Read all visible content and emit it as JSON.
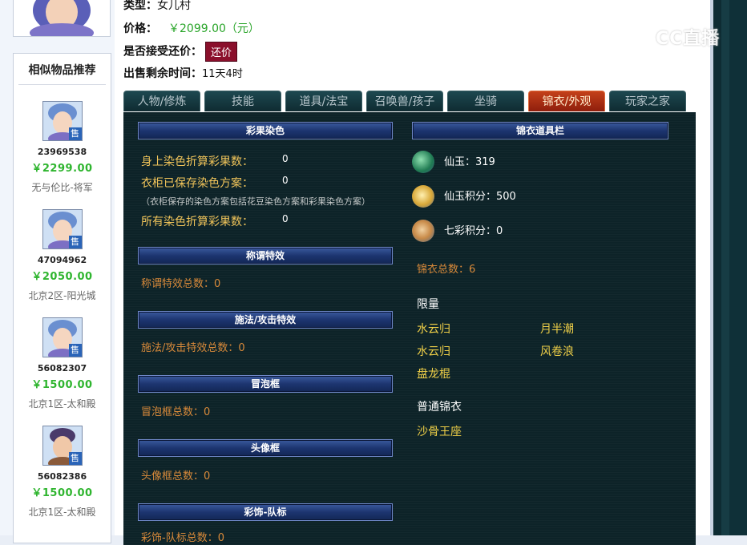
{
  "header": {
    "type_label": "类型：",
    "type_value": "女儿村",
    "price_label": "价格：",
    "price_value": "￥2099.00（元）",
    "bargain_label": "是否接受还价：",
    "bargain_button": "还价",
    "time_label": "出售剩余时间：",
    "time_value": "11天4时"
  },
  "watermark": "CC直播",
  "similar": {
    "title": "相似物品推荐",
    "items": [
      {
        "id": "23969538",
        "price": "￥2299.00",
        "server": "无与伦比-将军",
        "badge": "售"
      },
      {
        "id": "47094962",
        "price": "￥2050.00",
        "server": "北京2区-阳光城",
        "badge": "售"
      },
      {
        "id": "56082307",
        "price": "￥1500.00",
        "server": "北京1区-太和殿",
        "badge": "售"
      },
      {
        "id": "56082386",
        "price": "￥1500.00",
        "server": "北京1区-太和殿",
        "badge": "售"
      }
    ]
  },
  "tabs": [
    {
      "label": "人物/修炼",
      "active": false
    },
    {
      "label": "技能",
      "active": false
    },
    {
      "label": "道具/法宝",
      "active": false
    },
    {
      "label": "召唤兽/孩子",
      "active": false
    },
    {
      "label": "坐骑",
      "active": false
    },
    {
      "label": "锦衣/外观",
      "active": true
    },
    {
      "label": "玩家之家",
      "active": false
    }
  ],
  "left": {
    "dye_title": "彩果染色",
    "dye_rows": [
      {
        "label": "身上染色折算彩果数：",
        "value": "0"
      },
      {
        "label": "衣柜已保存染色方案：",
        "value": "0"
      }
    ],
    "dye_note": "（衣柜保存的染色方案包括花豆染色方案和彩果染色方案）",
    "dye_total": {
      "label": "所有染色折算彩果数：",
      "value": "0"
    },
    "title_fx_head": "称谓特效",
    "title_fx_count": "称谓特效总数：0",
    "cast_fx_head": "施法/攻击特效",
    "cast_fx_count": "施法/攻击特效总数：0",
    "bubble_head": "冒泡框",
    "bubble_count": "冒泡框总数：0",
    "avatar_frame_head": "头像框",
    "avatar_frame_count": "头像框总数：0",
    "team_head": "彩饰-队标",
    "team_count": "彩饰-队标总数：0"
  },
  "right": {
    "bar_title": "锦衣道具栏",
    "currencies": [
      {
        "label": "仙玉：319",
        "icon": "jade-icon",
        "color": "#2a9a6a"
      },
      {
        "label": "仙玉积分：500",
        "icon": "jade-points-icon",
        "color": "#d8b048"
      },
      {
        "label": "七彩积分：0",
        "icon": "rainbow-points-icon",
        "color": "#c8a070"
      }
    ],
    "jinyi_total": "锦衣总数：6",
    "limited_label": "限量",
    "limited_items": [
      "水云归",
      "月半潮",
      "水云归",
      "风卷浪",
      "盘龙棍"
    ],
    "normal_label": "普通锦衣",
    "normal_items": [
      "沙骨王座"
    ]
  },
  "colors": {
    "panel_bg": "#0d2328",
    "gold_text": "#f0c45a",
    "orange_text": "#d98a3a",
    "price_green": "#2fb52f",
    "active_tab": "#b33415"
  }
}
